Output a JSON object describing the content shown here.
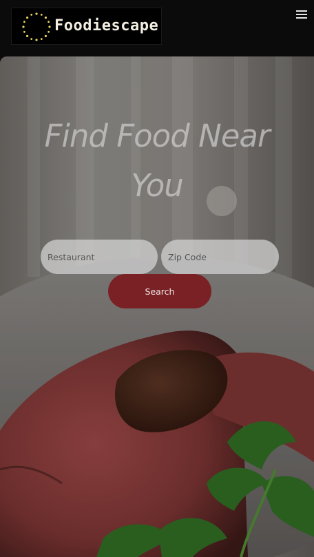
{
  "header": {
    "brand_name": "Foodiescape",
    "logo_icon": "sparkle-ring-icon",
    "menu_icon": "hamburger-menu-icon"
  },
  "hero": {
    "headline_line1": "Find Food Near",
    "headline_line2": "You",
    "background_image": "sliced-steak-with-sauce-and-parsley"
  },
  "search": {
    "restaurant_placeholder": "Restaurant",
    "zip_placeholder": "Zip Code",
    "button_label": "Search"
  },
  "colors": {
    "accent": "#7a2125",
    "navbar": "#0b0b0b",
    "input_background": "#d6d6d6",
    "logo_dots": "#e8d35a"
  }
}
